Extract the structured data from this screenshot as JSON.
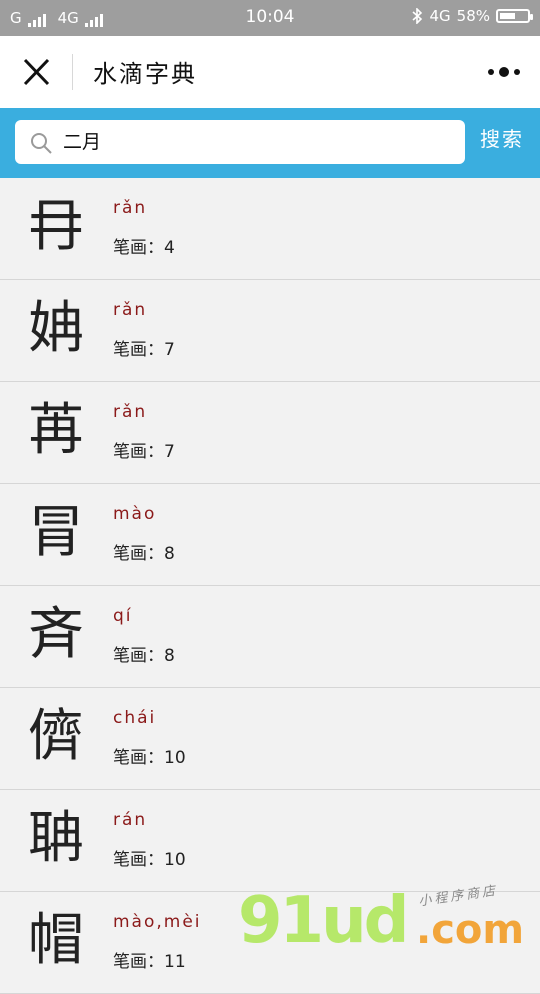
{
  "status_bar": {
    "carrier1": "G",
    "carrier2": "4G",
    "time": "10:04",
    "network": "4G",
    "battery": "58%",
    "battery_level": 0.58
  },
  "nav": {
    "title": "水滴字典"
  },
  "search": {
    "query": "二月",
    "button_label": "搜索"
  },
  "results": [
    {
      "char": "冄",
      "pinyin": "rǎn",
      "stroke_label": "笔画：",
      "strokes": "4"
    },
    {
      "char": "姌",
      "pinyin": "rǎn",
      "stroke_label": "笔画：",
      "strokes": "7"
    },
    {
      "char": "苒",
      "pinyin": "rǎn",
      "stroke_label": "笔画：",
      "strokes": "7"
    },
    {
      "char": "冐",
      "pinyin": "mào",
      "stroke_label": "笔画：",
      "strokes": "8"
    },
    {
      "char": "斉",
      "pinyin": "qí",
      "stroke_label": "笔画：",
      "strokes": "8"
    },
    {
      "char": "儕",
      "pinyin": "chái",
      "stroke_label": "笔画：",
      "strokes": "10"
    },
    {
      "char": "聃",
      "pinyin": "rán",
      "stroke_label": "笔画：",
      "strokes": "10"
    },
    {
      "char": "帽",
      "pinyin": "mào,mèi",
      "stroke_label": "笔画：",
      "strokes": "11"
    }
  ],
  "watermark": {
    "main": "91ud",
    "dot": ".com",
    "sub": "小程序商店"
  },
  "colors": {
    "search_bar": "#3aaedf",
    "pinyin": "#8b1a1a",
    "status_bar": "#9e9e9e"
  }
}
